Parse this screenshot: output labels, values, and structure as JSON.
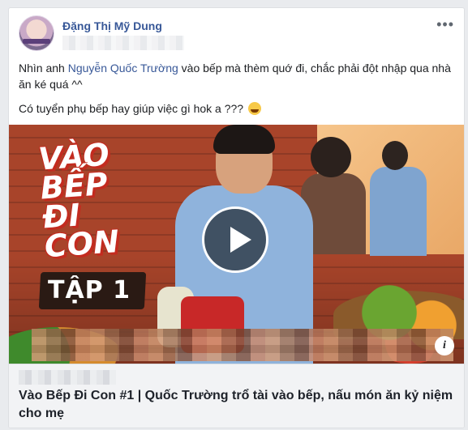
{
  "post": {
    "author": "Đặng Thị Mỹ Dung",
    "more_icon": "ellipsis-icon",
    "text_line1_before": "Nhìn anh ",
    "text_line1_mention": "Nguyễn Quốc Trường",
    "text_line1_after": " vào bếp mà thèm quớ đi, chắc phải đột nhập qua nhà ăn ké quá ^^",
    "text_line2": "Có tuyển phụ bếp hay giúp việc gì hok a ??? ",
    "emoji_icon": "laughing-emoji-icon"
  },
  "video": {
    "logo_lines": [
      "VÀO",
      "BẾP",
      "ĐI",
      "CON"
    ],
    "episode": "TẬP 1",
    "play_icon": "play-icon",
    "info_label": "i",
    "accent": "#c32b1f"
  },
  "link": {
    "title": "Vào Bếp Đi Con #1 | Quốc Trường trổ tài vào bếp, nấu món ăn kỷ niệm cho mẹ"
  },
  "colors": {
    "link_blue": "#385898",
    "background": "#e9ebee"
  }
}
